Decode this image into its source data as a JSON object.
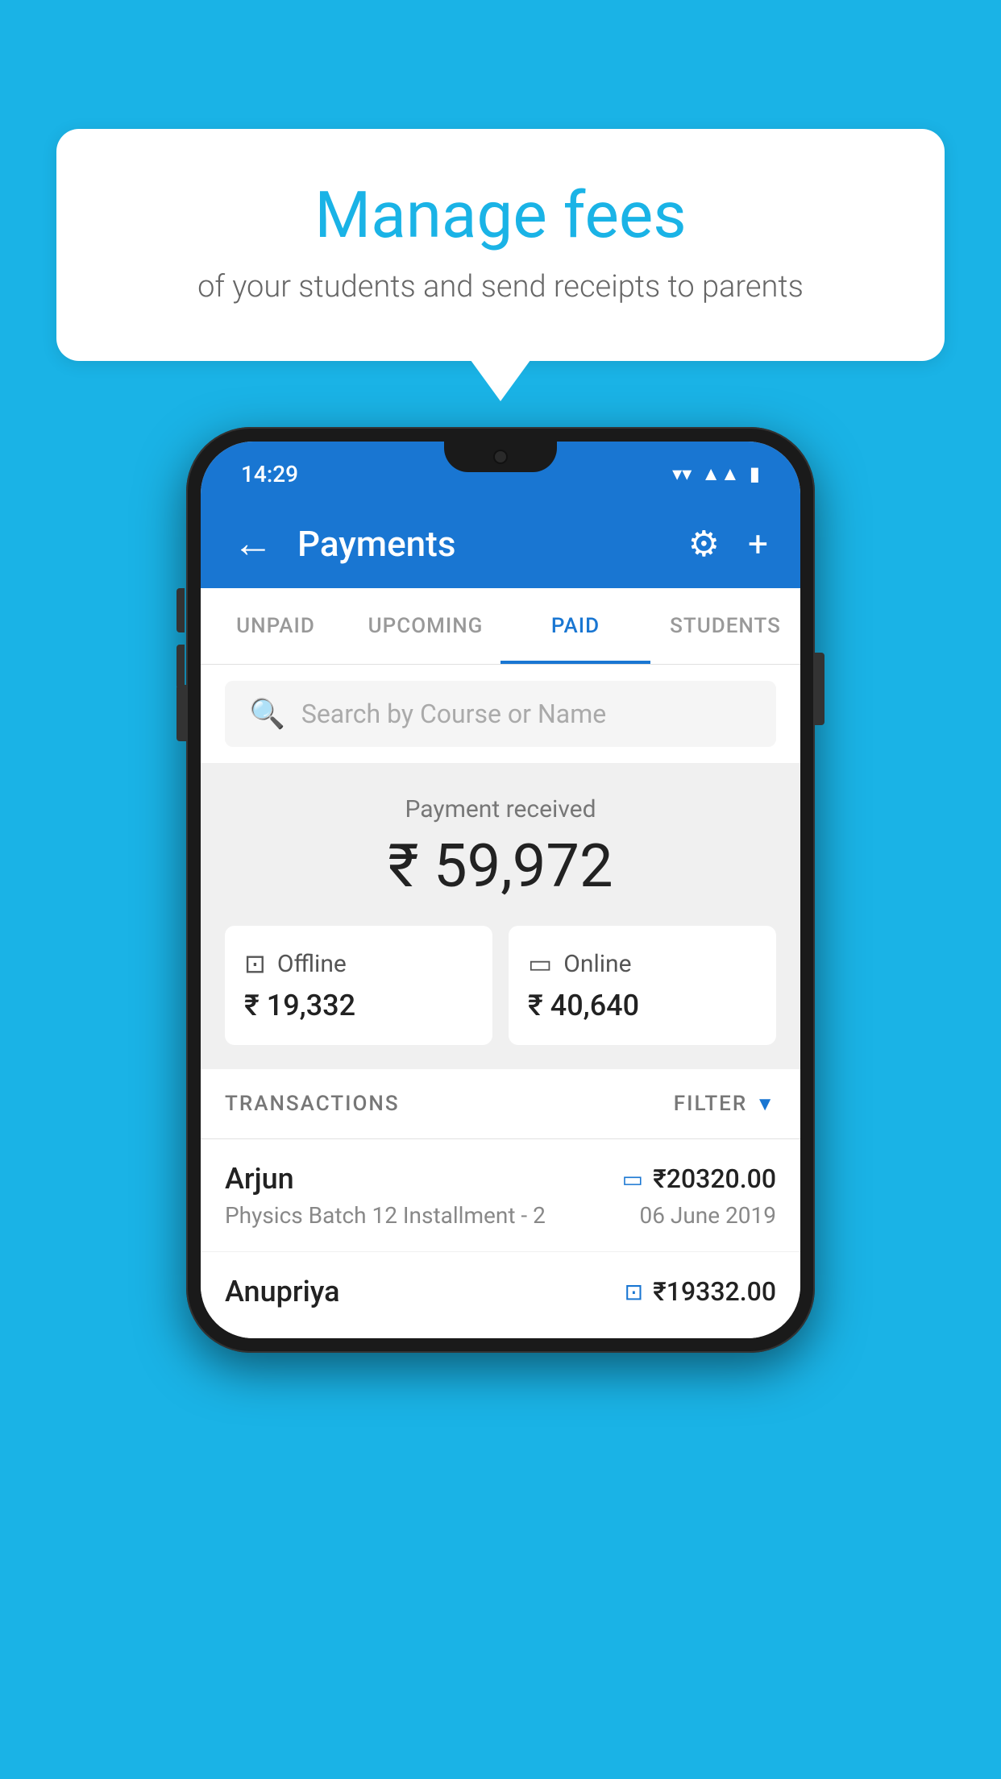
{
  "background_color": "#1ab3e6",
  "speech_bubble": {
    "title": "Manage fees",
    "subtitle": "of your students and send receipts to parents"
  },
  "status_bar": {
    "time": "14:29",
    "wifi": "▼",
    "signal": "▲",
    "battery": "▮"
  },
  "app_bar": {
    "back_label": "←",
    "title": "Payments",
    "settings_icon": "⚙",
    "add_icon": "+"
  },
  "tabs": [
    {
      "label": "UNPAID",
      "active": false
    },
    {
      "label": "UPCOMING",
      "active": false
    },
    {
      "label": "PAID",
      "active": true
    },
    {
      "label": "STUDENTS",
      "active": false
    }
  ],
  "search": {
    "placeholder": "Search by Course or Name"
  },
  "payment_received": {
    "label": "Payment received",
    "total": "₹ 59,972",
    "offline": {
      "type": "Offline",
      "amount": "₹ 19,332"
    },
    "online": {
      "type": "Online",
      "amount": "₹ 40,640"
    }
  },
  "transactions": {
    "header": "TRANSACTIONS",
    "filter_label": "FILTER",
    "rows": [
      {
        "name": "Arjun",
        "amount": "₹20320.00",
        "course": "Physics Batch 12 Installment - 2",
        "date": "06 June 2019",
        "payment_type": "card"
      },
      {
        "name": "Anupriya",
        "amount": "₹19332.00",
        "course": "",
        "date": "",
        "payment_type": "cash"
      }
    ]
  }
}
